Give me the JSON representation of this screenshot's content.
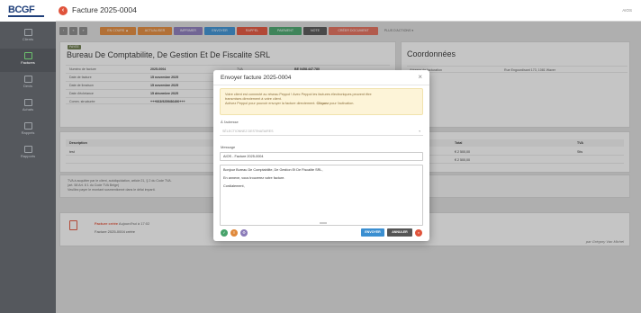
{
  "app": {
    "logo": "BCGF",
    "user": "AIOS",
    "page_title": "Facture 2025-0004"
  },
  "sidebar": {
    "items": [
      {
        "label": "Clients",
        "icon": "users-icon"
      },
      {
        "label": "Factures",
        "icon": "invoice-icon"
      },
      {
        "label": "Devis",
        "icon": "quote-icon"
      },
      {
        "label": "Achats",
        "icon": "purchase-icon"
      },
      {
        "label": "Rappels",
        "icon": "reminder-icon"
      },
      {
        "label": "Rapports",
        "icon": "chart-icon"
      }
    ]
  },
  "toolbar": {
    "buttons": [
      {
        "label": "EN COURS ▲",
        "color": "#e0893b"
      },
      {
        "label": "ACTUALISER",
        "color": "#e0893b"
      },
      {
        "label": "IMPRIMER",
        "color": "#8a7ab8"
      },
      {
        "label": "ENVOYER",
        "color": "#3b8fd1"
      },
      {
        "label": "RAPPEL",
        "color": "#e0533b"
      },
      {
        "label": "PAIEMENT",
        "color": "#47a36b"
      },
      {
        "label": "NOTE",
        "color": "#555555"
      },
      {
        "label": "CRÉER DOCUMENT",
        "color": "#e06c5a"
      },
      {
        "label": "PLUS D'ACTIONS ▾",
        "color": "#dddddd"
      }
    ]
  },
  "invoice": {
    "badge": "PAYÉE",
    "company": "Bureau De Comptabilite, De Gestion Et De Fiscalite SRL",
    "rows": [
      {
        "k": "Numéro de facture",
        "v": "2025-0004",
        "k2": "TVA",
        "v2": "BE 0458.447.780"
      },
      {
        "k": "Date de facture",
        "v": "15 novembre 2025"
      },
      {
        "k": "Date de livraison",
        "v": "15 novembre 2025"
      },
      {
        "k": "Date d'échéance",
        "v": "15 décembre 2025"
      },
      {
        "k": "Comm. structurée",
        "v": "+++063/9259/86490+++"
      }
    ]
  },
  "coordinates": {
    "title": "Coordonnées",
    "label": "Adresse de facturation",
    "value": "Rue Engourdisant 173, 1081 Waver"
  },
  "lines": {
    "headers": {
      "description": "Description",
      "total": "Total",
      "tva": "TVA"
    },
    "rows": [
      {
        "description": "test",
        "total": "€ 2 500,00",
        "tva": "Stts"
      },
      {
        "description": "",
        "total": "€ 2 500,00",
        "tva": ""
      }
    ]
  },
  "note": {
    "line1": "TVA à acquitter par le client, autoliquidation, article 21, § 2 du Code TVA.",
    "line2": "(art. 58 Art. 8 1 du Code TVA Belge)",
    "line3": "Veuillez payer le montant susmentionné dans le délai imparti."
  },
  "history": {
    "title": "Facture créée",
    "when": "Aujourd'hui à 17:02",
    "subtitle": "Facture 2025-0004 créée",
    "by": "par Grégory Van Michel"
  },
  "modal": {
    "title": "Envoyer facture 2025-0004",
    "close": "×",
    "alert_line1": "Votre client est connecté au réseau Peppol ! Avec Peppol les factures électroniques peuvent être",
    "alert_line2": "transmises directement à votre client.",
    "alert_line3_a": "Activez Peppol pour pouvoir envoyer la facture directement.",
    "alert_line3_b": "Cliquez",
    "alert_line3_c": "pour l'activation.",
    "to_label": "À l'adresse",
    "to_placeholder": "SÉLECTIONNEZ DESTINATAIRES",
    "message_label": "Message",
    "subject": "AIOS - Facture 2025-0004",
    "body": [
      "Bonjour Bureau De Comptabilite, De Gestion Et De Fiscalite SRL,",
      "En annexe, vous trouverez votre facture.",
      "Cordialement,"
    ],
    "send": "ENVOYER",
    "cancel": "ANNULER"
  },
  "colors": {
    "accent": "#e0533b",
    "sidebar": "#55585d",
    "send": "#3b8fd1",
    "cancel": "#555555"
  }
}
